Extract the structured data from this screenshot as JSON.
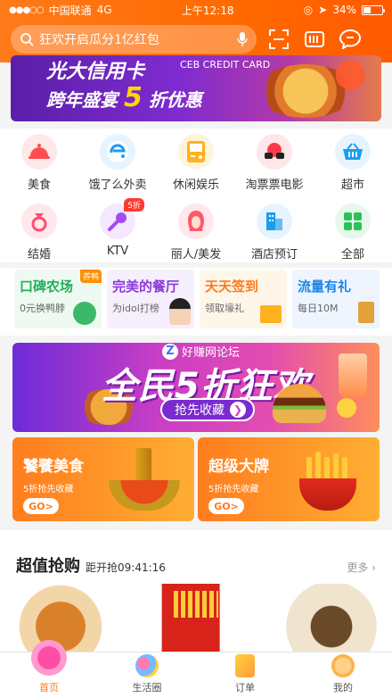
{
  "status_bar": {
    "carrier": "中国联通",
    "network": "4G",
    "time": "上午12:18",
    "battery": "34%"
  },
  "search": {
    "placeholder": "狂欢开启瓜分1亿红包"
  },
  "banner": {
    "brand": "光大信用卡",
    "brand_en": "CEB CREDIT CARD",
    "line1": "跨年盛宴",
    "discount": "5",
    "line2": "折优惠"
  },
  "grid": [
    {
      "label": "美食",
      "icon": "food-cloche-icon",
      "color": "#ff4d4f"
    },
    {
      "label": "饿了么外卖",
      "icon": "eleme-icon",
      "color": "#1a9df0"
    },
    {
      "label": "休闲娱乐",
      "icon": "gameboy-icon",
      "color": "#ffb21e"
    },
    {
      "label": "淘票票电影",
      "icon": "movie-glasses-icon",
      "color": "#ff3b4b"
    },
    {
      "label": "超市",
      "icon": "basket-icon",
      "color": "#1a9df0"
    },
    {
      "label": "结婚",
      "icon": "wedding-icon",
      "color": "#ff4d6a"
    },
    {
      "label": "KTV",
      "icon": "microphone-icon",
      "color": "#a44cf0",
      "badge": "5折"
    },
    {
      "label": "丽人/美发",
      "icon": "beauty-icon",
      "color": "#ff5a6a"
    },
    {
      "label": "酒店预订",
      "icon": "hotel-icon",
      "color": "#1a9df0"
    },
    {
      "label": "全部",
      "icon": "grid-icon",
      "color": "#2bc25a"
    }
  ],
  "promos": [
    {
      "title": "口碑农场",
      "sub": "0元换鸭脖",
      "tag": "养鸭",
      "color": "#1fae5a",
      "bg": "#eefaf1"
    },
    {
      "title": "完美的餐厅",
      "sub": "为idol打榜",
      "color": "#8a3ad8",
      "bg": "#f6effd"
    },
    {
      "title": "天天签到",
      "sub": "领取壕礼",
      "color": "#ff7a1a",
      "bg": "#fff6ea"
    },
    {
      "title": "流量有礼",
      "sub": "每日10M",
      "color": "#1a86e8",
      "bg": "#eef5ff"
    }
  ],
  "big_promo": {
    "watermark": "好赚网论坛",
    "title": "全民5折狂欢",
    "cta": "抢先收藏"
  },
  "cards": [
    {
      "title": "饕餮美食",
      "sub": "5折抢先收藏",
      "go": "GO"
    },
    {
      "title": "超级大牌",
      "sub": "5折抢先收藏",
      "go": "GO"
    }
  ],
  "section": {
    "title": "超值抢购",
    "time": "距开抢09:41:16",
    "more": "更多"
  },
  "tabs": [
    {
      "label": "首页",
      "active": true
    },
    {
      "label": "生活圈"
    },
    {
      "label": "订单"
    },
    {
      "label": "我的"
    }
  ],
  "colors": {
    "accent": "#ff7a1a"
  }
}
